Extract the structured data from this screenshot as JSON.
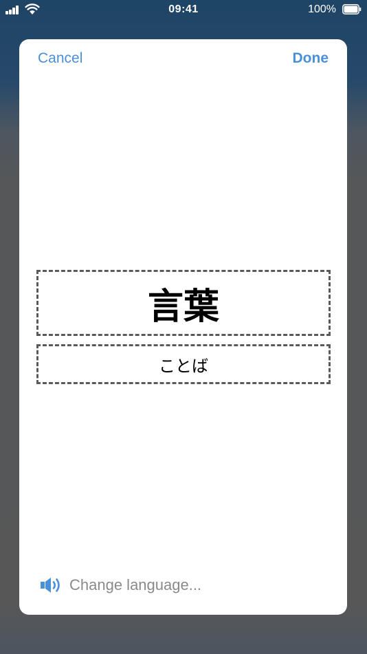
{
  "status_bar": {
    "time": "09:41",
    "battery_percent": "100%",
    "signal_icon": "cellular-signal-icon",
    "wifi_icon": "wifi-icon",
    "battery_icon": "battery-full-icon"
  },
  "nav": {
    "cancel_label": "Cancel",
    "done_label": "Done"
  },
  "editor": {
    "word": "言葉",
    "reading": "ことば"
  },
  "footer": {
    "change_language_label": "Change language...",
    "speaker_icon": "speaker-icon"
  },
  "colors": {
    "accent": "#4a90d9",
    "secondary_text": "#8a8a8a",
    "dashed_border": "#5a5a5a"
  }
}
